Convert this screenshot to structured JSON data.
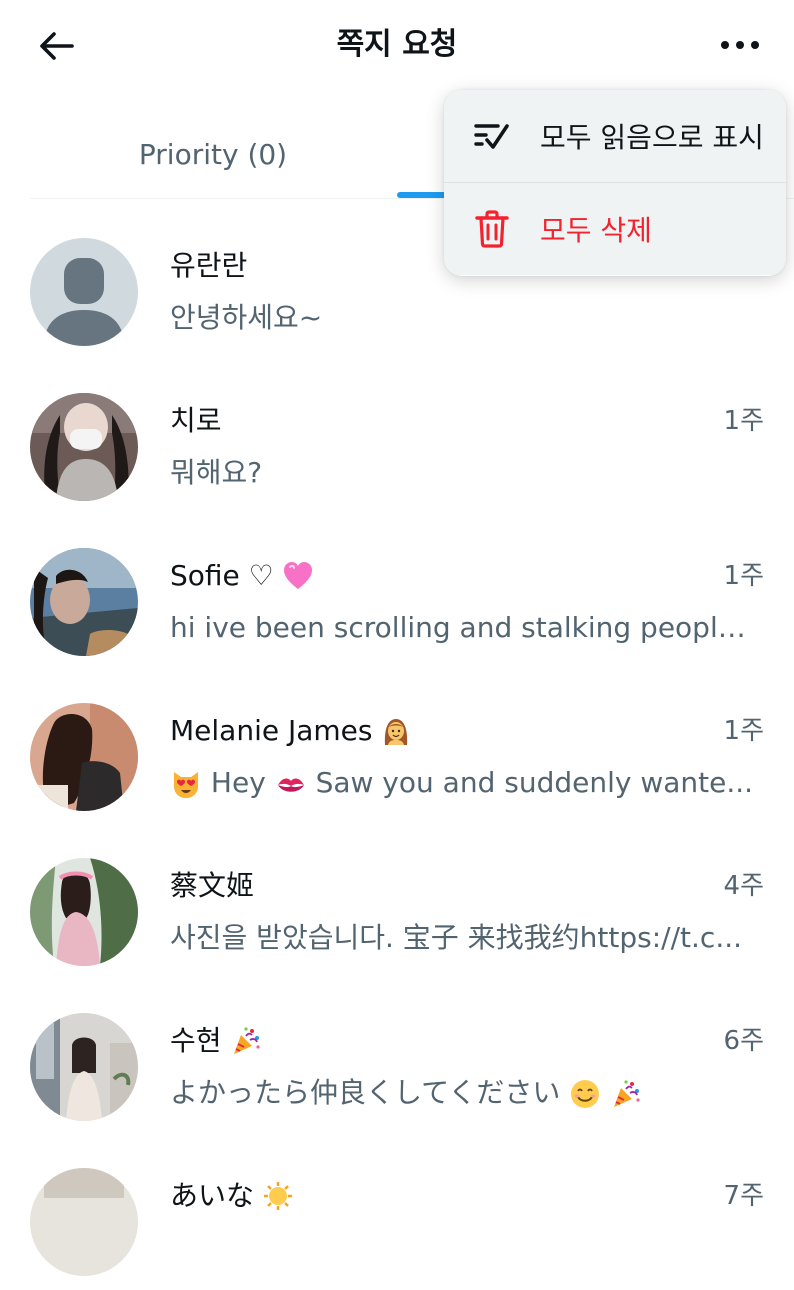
{
  "header": {
    "title": "쪽지 요청",
    "back_icon": "back-arrow-icon",
    "more_icon": "more-horizontal-icon"
  },
  "tabs": [
    {
      "label": "Priority (0)"
    },
    {
      "label": ""
    }
  ],
  "menu": {
    "mark_all_read": {
      "label": "모두 읽음으로 표시",
      "icon": "check-list-icon"
    },
    "delete_all": {
      "label": "모두 삭제",
      "icon": "trash-icon",
      "color": "#f4212e"
    }
  },
  "conversations": [
    {
      "name": "유란란",
      "time": "",
      "preview": "안녕하세요~"
    },
    {
      "name": "치로",
      "time": "1주",
      "preview": "뭐해요?"
    },
    {
      "name": "Sofie ♡",
      "time": "1주",
      "preview": "hi ive been scrolling and stalking people'..."
    },
    {
      "name": "Melanie James",
      "time": "1주",
      "preview_pre": "Hey",
      "preview_post": "Saw you and suddenly wante..."
    },
    {
      "name": "蔡文姬",
      "time": "4주",
      "preview": "사진을 받았습니다. 宝子 来找我约https://t.c..."
    },
    {
      "name": "수현",
      "time": "6주",
      "preview": "よかったら仲良くしてください"
    },
    {
      "name": "あいな",
      "time": "7주",
      "preview": ""
    }
  ],
  "colors": {
    "accent": "#1d9bf0",
    "secondary_text": "#536471",
    "danger": "#f4212e"
  }
}
